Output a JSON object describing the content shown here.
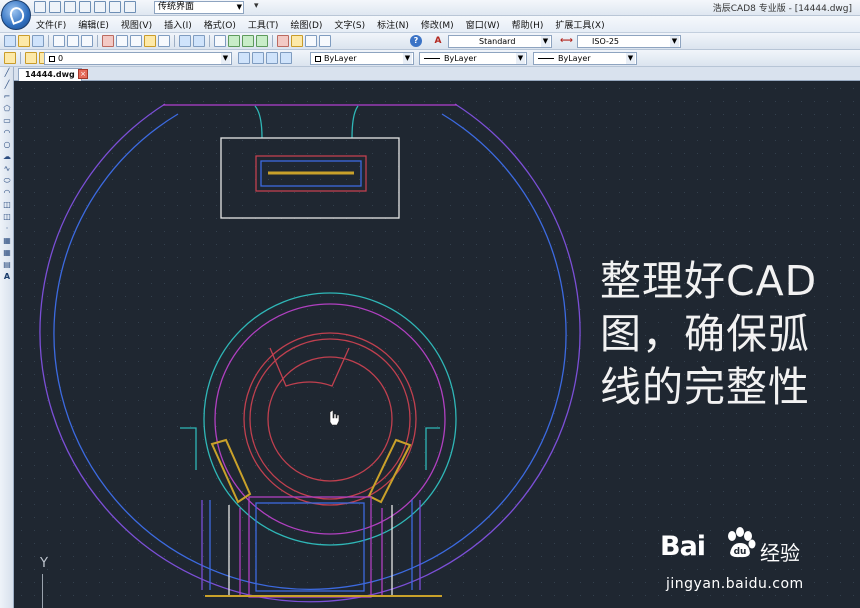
{
  "app": {
    "title": "浩辰CAD8 专业版 - [14444.dwg]",
    "workspace": "传统界面",
    "quick_access_extra": "▾"
  },
  "menu": [
    "文件(F)",
    "编辑(E)",
    "视图(V)",
    "插入(I)",
    "格式(O)",
    "工具(T)",
    "绘图(D)",
    "文字(S)",
    "标注(N)",
    "修改(M)",
    "窗口(W)",
    "帮助(H)",
    "扩展工具(X)"
  ],
  "toolbar": {
    "text_style": "Standard",
    "dim_style": "ISO-25",
    "layer": "0",
    "color": "ByLayer",
    "linetype": "ByLayer",
    "lineweight": "ByLayer",
    "help_label": "?"
  },
  "tabs": [
    {
      "label": "14444.dwg",
      "active": true
    }
  ],
  "tab_close_label": "×",
  "left_tools": [
    "line-icon",
    "xline-icon",
    "polyline-icon",
    "polygon-icon",
    "rectangle-icon",
    "arc-icon",
    "circle-icon",
    "revcloud-icon",
    "spline-icon",
    "ellipse-icon",
    "ellipse-arc-icon",
    "insert-block-icon",
    "make-block-icon",
    "point-icon",
    "hatch-icon",
    "region-icon",
    "table-icon",
    "text-icon"
  ],
  "left_tool_text_label": "A",
  "overlay_text": [
    "整理好CAD",
    "图，确保弧",
    "线的完整性"
  ],
  "ucs": {
    "y_label": "Y"
  },
  "watermark": {
    "brand": "Bai",
    "brand_suffix": "经验",
    "url": "jingyan.baidu.com"
  },
  "colors": {
    "canvas_bg": "#1f2731",
    "purple": "#8a4fd8",
    "blue": "#3c6ae0",
    "cyan": "#2fb7b7",
    "white": "#e6e6e6",
    "magenta": "#c040c0",
    "yellow": "#c9a12a",
    "red": "#c0404f"
  }
}
